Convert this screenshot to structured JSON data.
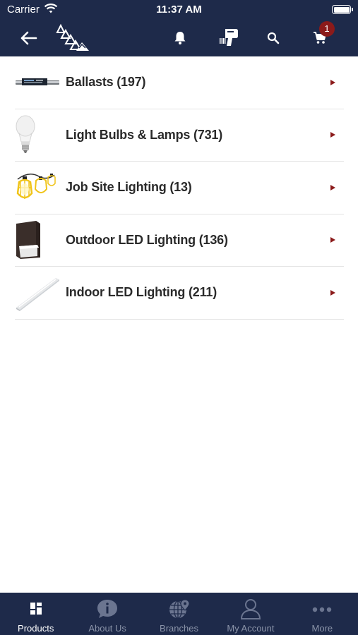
{
  "status_bar": {
    "carrier": "Carrier",
    "time": "11:37 AM"
  },
  "header": {
    "cart_badge": "1",
    "icons": [
      "back-arrow-icon",
      "logo",
      "bell-icon",
      "barcode-scanner-icon",
      "search-icon",
      "cart-icon"
    ]
  },
  "categories": [
    {
      "label": "Ballasts (197)",
      "image": "ballast"
    },
    {
      "label": "Light Bulbs & Lamps (731)",
      "image": "light-bulb"
    },
    {
      "label": "Job Site Lighting (13)",
      "image": "job-site-light"
    },
    {
      "label": "Outdoor LED Lighting (136)",
      "image": "outdoor-wall-pack"
    },
    {
      "label": "Indoor LED Lighting (211)",
      "image": "indoor-strip-light"
    }
  ],
  "tabs": [
    {
      "label": "Products",
      "icon": "grid-icon",
      "active": true
    },
    {
      "label": "About Us",
      "icon": "info-bubble-icon",
      "active": false
    },
    {
      "label": "Branches",
      "icon": "globe-pin-icon",
      "active": false
    },
    {
      "label": "My Account",
      "icon": "person-icon",
      "active": false
    },
    {
      "label": "More",
      "icon": "more-dots-icon",
      "active": false
    }
  ],
  "colors": {
    "header_bg": "#1e2a4a",
    "accent": "#8b1a1a",
    "tab_inactive": "#8a93a8",
    "tab_active": "#ffffff"
  }
}
